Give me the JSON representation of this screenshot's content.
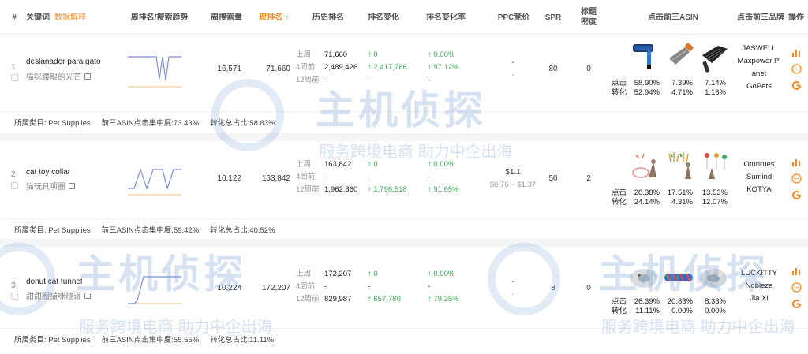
{
  "header": {
    "idx": "#",
    "keyword": "关键词",
    "data_explain": "数据解释",
    "weekly_rank_trend": "周排名/搜索趋势",
    "weekly_search": "周搜索量",
    "current_rank": "现排名 ↑",
    "history_rank": "历史排名",
    "rank_change": "排名变化",
    "rank_change_rate": "排名变化率",
    "ppc": "PPC竞价",
    "spr": "SPR",
    "title_density_1": "标题",
    "title_density_2": "密度",
    "top3_asin": "点击前三ASIN",
    "top3_brand": "点击前三品牌",
    "ops": "操作"
  },
  "rows": [
    {
      "idx": "1",
      "keyword": "deslanador para gato",
      "keyword_cn": "猫咪腰眼的光芒",
      "weekly_search": "16,571",
      "current_rank": "71,660",
      "hist": [
        {
          "label": "上周",
          "value": "71,660",
          "change": "↑ 0",
          "rate": "↑ 0.00%"
        },
        {
          "label": "4周前",
          "value": "2,489,426",
          "change": "↑ 2,417,766",
          "rate": "↑ 97.12%"
        },
        {
          "label": "12周前",
          "value": "-",
          "change": "-",
          "rate": "-"
        }
      ],
      "ppc_main": "-",
      "ppc_range": "-",
      "spr": "80",
      "title_density": "0",
      "click_label": "点击",
      "conv_label": "转化",
      "asins": [
        {
          "click": "58.90%",
          "conv": "52.94%"
        },
        {
          "click": "7.39%",
          "conv": "4.71%"
        },
        {
          "click": "7.14%",
          "conv": "1.18%"
        }
      ],
      "brands": [
        "JASWELL",
        "Maxpower Pl",
        "anet",
        "GoPets"
      ],
      "category_label": "所属类目: Pet Supplies",
      "concentration_label": "前三ASIN点击集中度:73.43%",
      "conversion_label": "转化总占比:58.83%"
    },
    {
      "idx": "2",
      "keyword": "cat toy collar",
      "keyword_cn": "猫玩具项圈",
      "weekly_search": "10,122",
      "current_rank": "163,842",
      "hist": [
        {
          "label": "上周",
          "value": "163,842",
          "change": "↑ 0",
          "rate": "↑ 0.00%"
        },
        {
          "label": "4周前",
          "value": "-",
          "change": "-",
          "rate": "-"
        },
        {
          "label": "12周前",
          "value": "1,962,360",
          "change": "↑ 1,798,518",
          "rate": "↑ 91.65%"
        }
      ],
      "ppc_main": "$1.1",
      "ppc_range": "$0.76 ~ $1.37",
      "spr": "50",
      "title_density": "2",
      "click_label": "点击",
      "conv_label": "转化",
      "asins": [
        {
          "click": "28.38%",
          "conv": "24.14%"
        },
        {
          "click": "17.51%",
          "conv": "4.31%"
        },
        {
          "click": "13.53%",
          "conv": "12.07%"
        }
      ],
      "brands": [
        "Otunrues",
        "Sumind",
        "KOTYA"
      ],
      "category_label": "所属类目: Pet Supplies",
      "concentration_label": "前三ASIN点击集中度:59.42%",
      "conversion_label": "转化总占比:40.52%"
    },
    {
      "idx": "3",
      "keyword": "donut cat tunnel",
      "keyword_cn": "甜甜圈猫咪隧道",
      "weekly_search": "10,224",
      "current_rank": "172,207",
      "hist": [
        {
          "label": "上周",
          "value": "172,207",
          "change": "↑ 0",
          "rate": "↑ 0.00%"
        },
        {
          "label": "4周前",
          "value": "-",
          "change": "-",
          "rate": "-"
        },
        {
          "label": "12周前",
          "value": "829,987",
          "change": "↑ 657,780",
          "rate": "↑ 79.25%"
        }
      ],
      "ppc_main": "-",
      "ppc_range": "-",
      "spr": "8",
      "title_density": "0",
      "click_label": "点击",
      "conv_label": "转化",
      "asins": [
        {
          "click": "26.39%",
          "conv": "11.11%"
        },
        {
          "click": "20.83%",
          "conv": "0.00%"
        },
        {
          "click": "8.33%",
          "conv": "0.00%"
        }
      ],
      "brands": [
        "LUCKITTY",
        "Nobleza",
        "Jia Xi"
      ],
      "category_label": "所属类目: Pet Supplies",
      "concentration_label": "前三ASIN点击集中度:55.55%",
      "conversion_label": "转化总占比:11.11%"
    }
  ],
  "watermark": {
    "brand": "主机侦探",
    "slogan": "服务跨境电商  助力中企出海"
  },
  "colors": {
    "accent_orange": "#f08a24",
    "green_up": "#3aa757",
    "trend_line": "#7b8fd6",
    "trend_base": "#f5c084"
  },
  "icons": [
    "bar-chart-icon",
    "more-icon",
    "google-icon",
    "edit-icon"
  ]
}
